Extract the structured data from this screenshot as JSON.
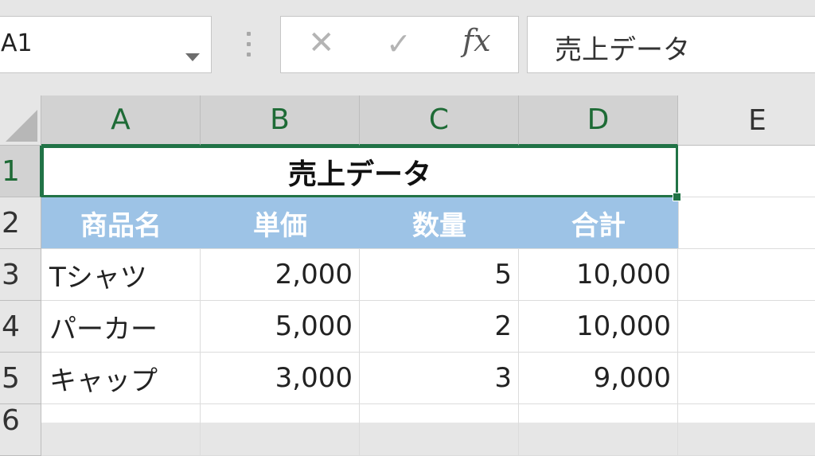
{
  "name_box": {
    "value": "A1"
  },
  "formula_bar": {
    "cancel_label": "✕",
    "enter_label": "✓",
    "fx_label": "fx",
    "content": "売上データ"
  },
  "columns": [
    "A",
    "B",
    "C",
    "D",
    "E"
  ],
  "rows": [
    "1",
    "2",
    "3",
    "4",
    "5",
    "6"
  ],
  "sheet": {
    "title": "売上データ",
    "headers": [
      "商品名",
      "単価",
      "数量",
      "合計"
    ],
    "data": [
      [
        "Tシャツ",
        "2,000",
        "5",
        "10,000"
      ],
      [
        "パーカー",
        "5,000",
        "2",
        "10,000"
      ],
      [
        "キャップ",
        "3,000",
        "3",
        "9,000"
      ]
    ]
  },
  "colors": {
    "header_fill": "#9dc3e6",
    "selection": "#217346"
  }
}
